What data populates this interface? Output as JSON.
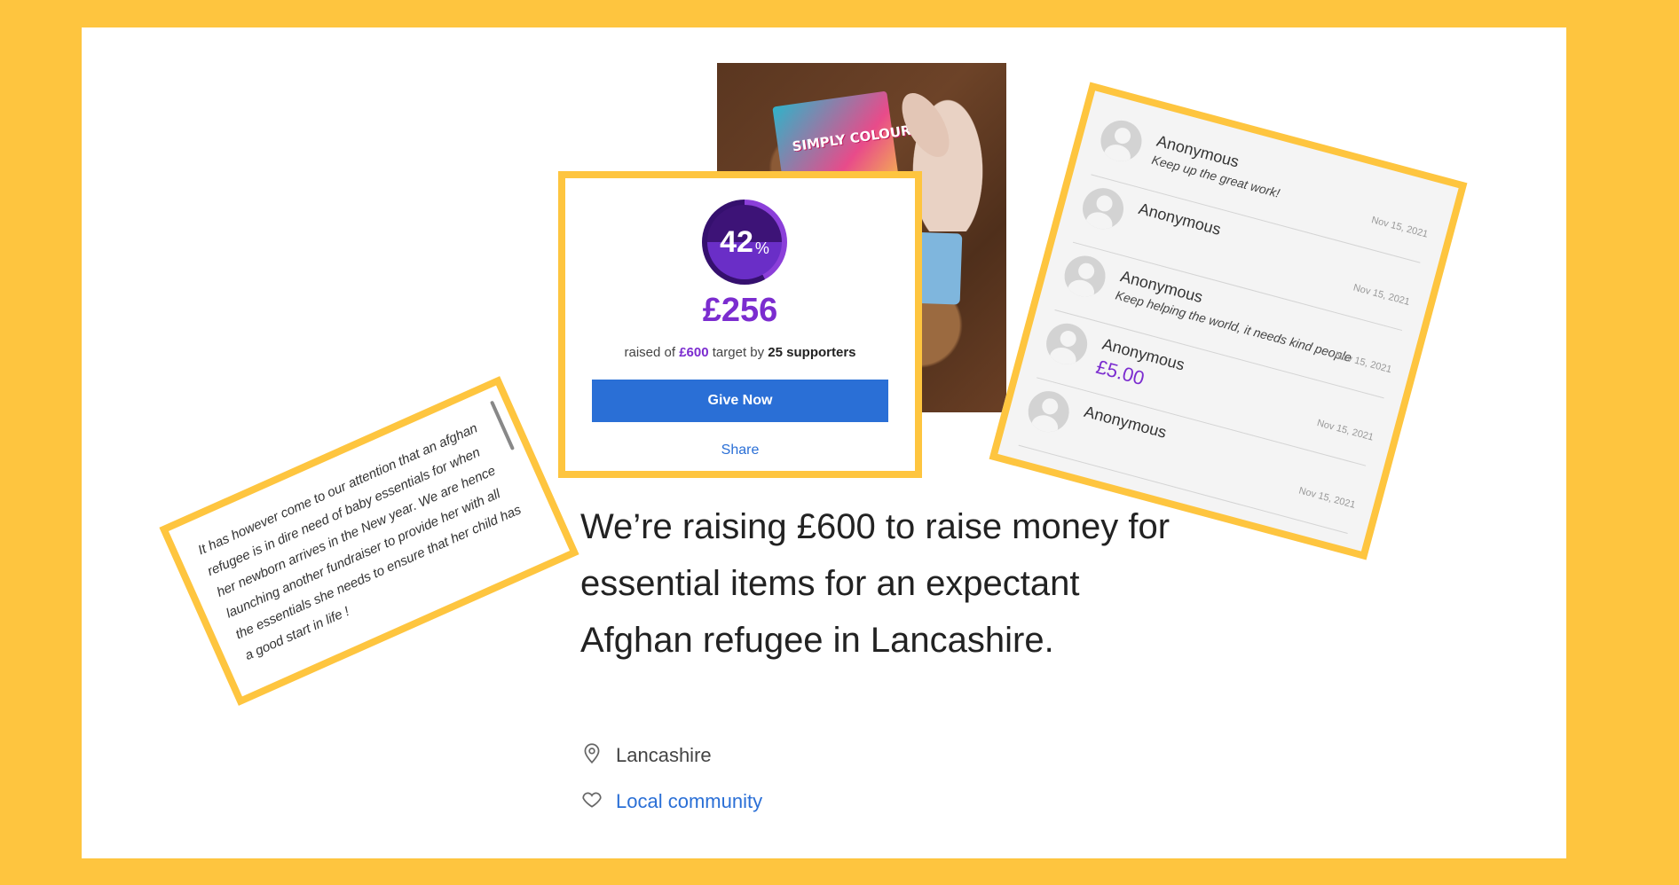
{
  "progress": {
    "percent": 42,
    "percent_num": "42",
    "percent_sign": "%",
    "raised": "£256",
    "raised_prefix": "raised of",
    "target": "£600",
    "target_mid": "target by",
    "supporters": "25 supporters",
    "give_label": "Give Now",
    "share_label": "Share"
  },
  "photo": {
    "book_text": "SIMPLY COLOURING"
  },
  "description": {
    "text": "It has however come to our attention that an afghan refugee is in dire need of baby essentials for when her newborn arrives in the New year. We are hence launching another fundraiser to provide her with all the essentials she needs to ensure that her child has a good start in life !"
  },
  "comments": [
    {
      "name": "Anonymous",
      "message": "Keep up the great work!",
      "date": "Nov 15, 2021"
    },
    {
      "name": "Anonymous",
      "message": "",
      "date": "Nov 15, 2021"
    },
    {
      "name": "Anonymous",
      "message": "Keep helping the world, it needs kind people",
      "date": "Nov 15, 2021"
    },
    {
      "name": "Anonymous",
      "amount": "£5.00",
      "date": "Nov 15, 2021"
    },
    {
      "name": "Anonymous",
      "message": "",
      "date": "Nov 15, 2021"
    }
  ],
  "headline": "We’re raising £600 to raise money for essential items for an expectant Afghan refugee in Lancashire.",
  "meta": {
    "location": "Lancashire",
    "category": "Local community",
    "location_icon": "location-pin-icon",
    "category_icon": "heart-icon"
  },
  "colors": {
    "frame": "#fec53f",
    "accent_purple": "#7b2ccf",
    "button_blue": "#2a6fd6"
  }
}
